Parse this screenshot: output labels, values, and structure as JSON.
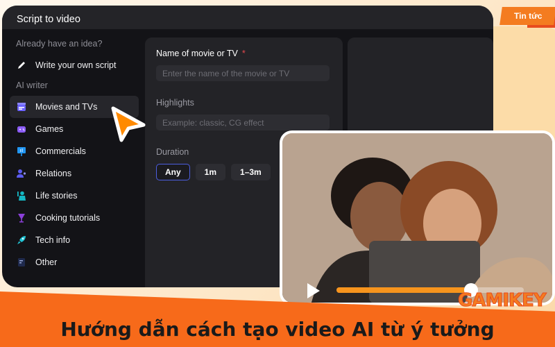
{
  "badge": {
    "label": "Tin tức"
  },
  "app": {
    "title": "Script to video",
    "sidebar": {
      "idea_heading": "Already have an idea?",
      "write_item": {
        "label": "Write your own script",
        "icon": "pencil-icon"
      },
      "ai_heading": "AI writer",
      "items": [
        {
          "label": "Movies and TVs",
          "icon": "clapperboard-icon",
          "color": "#6c63ff",
          "active": true
        },
        {
          "label": "Games",
          "icon": "gamepad-icon",
          "color": "#8b5cf6"
        },
        {
          "label": "Commercials",
          "icon": "billboard-icon",
          "color": "#2196f3"
        },
        {
          "label": "Relations",
          "icon": "people-icon",
          "color": "#5b5bf0"
        },
        {
          "label": "Life stories",
          "icon": "person-wave-icon",
          "color": "#14b8c4"
        },
        {
          "label": "Cooking tutorials",
          "icon": "goblet-icon",
          "color": "#8b3fd9"
        },
        {
          "label": "Tech info",
          "icon": "rocket-icon",
          "color": "#22c5d6"
        },
        {
          "label": "Other",
          "icon": "note-icon",
          "color": "#3b4a7a"
        }
      ]
    },
    "form": {
      "name_label": "Name of movie or TV",
      "required_mark": "*",
      "name_placeholder": "Enter the name of the movie or TV",
      "highlights_label": "Highlights",
      "highlights_placeholder": "Example: classic, CG effect",
      "duration_label": "Duration",
      "duration_options": [
        "Any",
        "1m",
        "1–3m"
      ],
      "duration_selected": "Any"
    }
  },
  "video": {
    "progress": 0.72,
    "play_icon": "play-icon"
  },
  "logo": {
    "text": "GAMIKEY"
  },
  "footer": {
    "title": "Hướng dẫn cách tạo video AI từ ý tưởng"
  }
}
